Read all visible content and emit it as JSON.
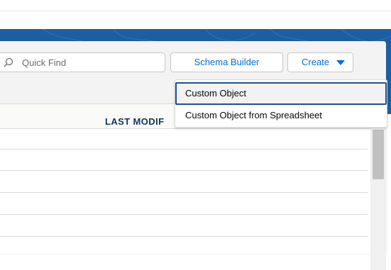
{
  "search": {
    "placeholder": "Quick Find"
  },
  "toolbar": {
    "schema_builder_label": "Schema Builder",
    "create_label": "Create"
  },
  "table": {
    "columns": [
      "LAST MODIFIED"
    ],
    "column_visible_text": "LAST MODIF",
    "row_count": 6
  },
  "dropdown": {
    "items": [
      {
        "label": "Custom Object",
        "focused": true
      },
      {
        "label": "Custom Object from Spreadsheet",
        "focused": false
      }
    ]
  },
  "colors": {
    "brand_band": "#1b5ea3",
    "link_blue": "#0070d2",
    "header_text": "#16325c",
    "focus_border": "#1b5297"
  },
  "icons": [
    "search-icon",
    "chevron-down-icon"
  ]
}
